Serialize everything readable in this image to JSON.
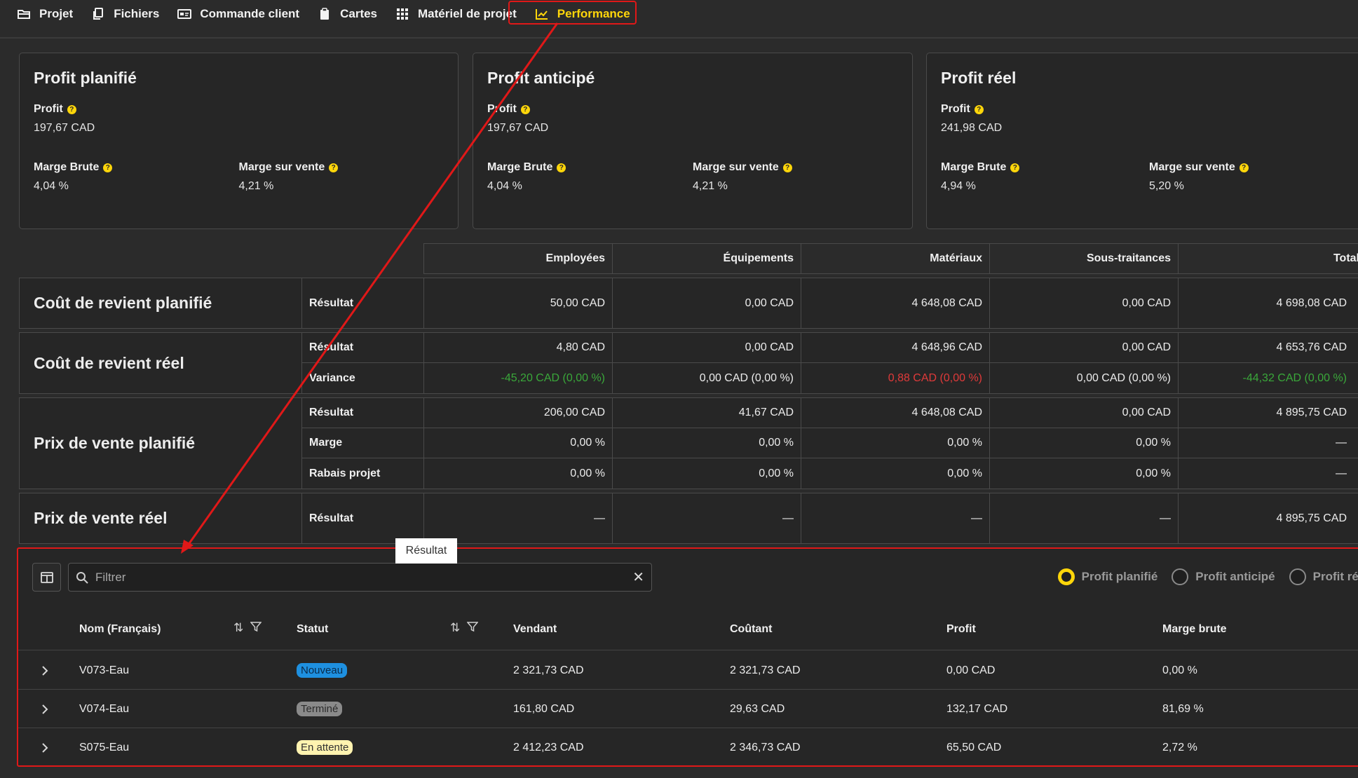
{
  "nav": {
    "items": [
      {
        "label": "Projet",
        "icon": "folder-open-icon"
      },
      {
        "label": "Fichiers",
        "icon": "files-icon"
      },
      {
        "label": "Commande client",
        "icon": "id-card-icon"
      },
      {
        "label": "Cartes",
        "icon": "clipboard-icon"
      },
      {
        "label": "Matériel de projet",
        "icon": "grid-icon"
      },
      {
        "label": "Performance",
        "icon": "line-chart-icon",
        "active": true
      }
    ]
  },
  "cards": [
    {
      "title": "Profit planifié",
      "profit_label": "Profit",
      "profit_value": "197,67 CAD",
      "gross_label": "Marge Brute",
      "gross_value": "4,04 %",
      "sales_label": "Marge sur vente",
      "sales_value": "4,21 %"
    },
    {
      "title": "Profit anticipé",
      "profit_label": "Profit",
      "profit_value": "197,67 CAD",
      "gross_label": "Marge Brute",
      "gross_value": "4,04 %",
      "sales_label": "Marge sur vente",
      "sales_value": "4,21 %"
    },
    {
      "title": "Profit réel",
      "profit_label": "Profit",
      "profit_value": "241,98 CAD",
      "gross_label": "Marge Brute",
      "gross_value": "4,94 %",
      "sales_label": "Marge sur vente",
      "sales_value": "5,20 %"
    }
  ],
  "grid": {
    "columns": [
      "Employées",
      "Équipements",
      "Matériaux",
      "Sous-traitances",
      "Total"
    ],
    "blocks": [
      {
        "title": "Coût de revient planifié",
        "rows": [
          {
            "label": "Résultat",
            "values": [
              "50,00 CAD",
              "0,00 CAD",
              "4 648,08 CAD",
              "0,00 CAD",
              "4 698,08 CAD"
            ]
          }
        ]
      },
      {
        "title": "Coût de revient réel",
        "rows": [
          {
            "label": "Résultat",
            "values": [
              "4,80 CAD",
              "0,00 CAD",
              "4 648,96 CAD",
              "0,00 CAD",
              "4 653,76 CAD"
            ]
          },
          {
            "label": "Variance",
            "values": [
              "-45,20 CAD (0,00 %)",
              "0,00 CAD (0,00 %)",
              "0,88 CAD (0,00 %)",
              "0,00 CAD (0,00 %)",
              "-44,32 CAD (0,00 %)"
            ]
          }
        ]
      },
      {
        "title": "Prix de vente planifié",
        "rows": [
          {
            "label": "Résultat",
            "values": [
              "206,00 CAD",
              "41,67 CAD",
              "4 648,08 CAD",
              "0,00 CAD",
              "4 895,75 CAD"
            ]
          },
          {
            "label": "Marge",
            "values": [
              "0,00 %",
              "0,00 %",
              "0,00 %",
              "0,00 %",
              "—"
            ]
          },
          {
            "label": "Rabais projet",
            "values": [
              "0,00 %",
              "0,00 %",
              "0,00 %",
              "0,00 %",
              "—"
            ]
          }
        ]
      },
      {
        "title": "Prix de vente réel",
        "rows": [
          {
            "label": "Résultat",
            "values": [
              "—",
              "—",
              "—",
              "—",
              "4 895,75 CAD"
            ]
          }
        ]
      }
    ],
    "variance_colors": {
      "negative": "#3aa83a",
      "positive": "#e03a3a"
    }
  },
  "tooltip": "Résultat",
  "table": {
    "filter_placeholder": "Filtrer",
    "radios": [
      {
        "label": "Profit planifié",
        "checked": true
      },
      {
        "label": "Profit anticipé",
        "checked": false
      },
      {
        "label": "Profit réel",
        "checked": false
      }
    ],
    "headers": [
      "Nom (Français)",
      "Statut",
      "Vendant",
      "Coûtant",
      "Profit",
      "Marge brute"
    ],
    "rows": [
      {
        "name": "V073-Eau",
        "status": "Nouveau",
        "status_kind": "blue",
        "vendant": "2 321,73 CAD",
        "coutant": "2 321,73 CAD",
        "profit": "0,00 CAD",
        "marge": "0,00 %"
      },
      {
        "name": "V074-Eau",
        "status": "Terminé",
        "status_kind": "gray",
        "vendant": "161,80 CAD",
        "coutant": "29,63 CAD",
        "profit": "132,17 CAD",
        "marge": "81,69 %"
      },
      {
        "name": "S075-Eau",
        "status": "En attente",
        "status_kind": "yellow",
        "vendant": "2 412,23 CAD",
        "coutant": "2 346,73 CAD",
        "profit": "65,50 CAD",
        "marge": "2,72 %"
      }
    ]
  },
  "colors": {
    "accent": "#ffd60a",
    "annotation": "#e01818",
    "background": "#2b2b2b"
  }
}
